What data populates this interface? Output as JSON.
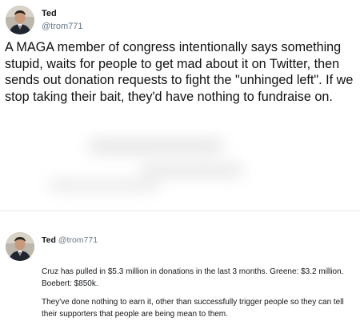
{
  "main_tweet": {
    "name": "Ted",
    "handle": "@trom771",
    "text": "A MAGA member of congress intentionally says something stupid, waits for people to get mad about it on Twitter, then sends out donation requests to fight the \"unhinged left\". If we stop taking their bait, they'd have nothing to fundraise on."
  },
  "quoted_tweet": {
    "name": "Ted",
    "handle": "@trom771",
    "paragraph_1": "Cruz has pulled in $5.3 million in donations in the last 3 months. Greene: $3.2 million. Boebert: $850k.",
    "paragraph_2": "They've done nothing to earn it, other than successfully trigger people so they can tell their supporters that people are being mean to them."
  },
  "icons": {
    "avatar": "profile-photo"
  }
}
